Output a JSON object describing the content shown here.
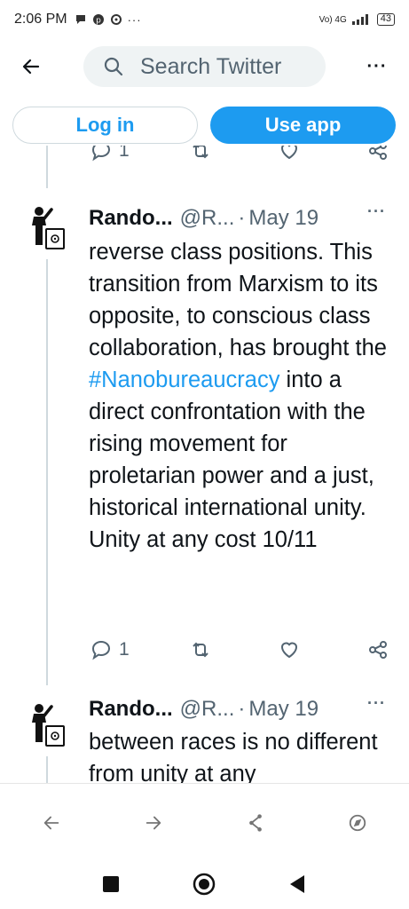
{
  "status_bar": {
    "time": "2:06 PM",
    "right_label": "Vo) 4G",
    "network": "4G",
    "battery": "43"
  },
  "topbar": {
    "search_placeholder": "Search Twitter"
  },
  "auth": {
    "login_label": "Log in",
    "app_label": "Use app"
  },
  "prev_tweet_actions": {
    "reply_count": "1"
  },
  "tweets": [
    {
      "name": "Rando...",
      "handle": "@R...",
      "date": "May 19",
      "text_before": "reverse class positions. This transition from Marxism to its opposite, to conscious class collaboration, has brought the ",
      "hashtag": "#Nanobureaucracy",
      "text_after": " into a direct confrontation with the rising movement for proletarian power and a just, historical international unity. Unity at any cost 10/11",
      "reply_count": "1"
    },
    {
      "name": "Rando...",
      "handle": "@R...",
      "date": "May 19",
      "text": "between races is no different from unity at any"
    }
  ],
  "icons": {
    "back": "arrow-left-icon",
    "search": "search-icon",
    "more": "more-icon",
    "reply": "reply-icon",
    "retweet": "retweet-icon",
    "like": "heart-icon",
    "share": "share-icon"
  },
  "colors": {
    "accent": "#1d9bf0",
    "text": "#0f1419",
    "muted": "#536471"
  }
}
